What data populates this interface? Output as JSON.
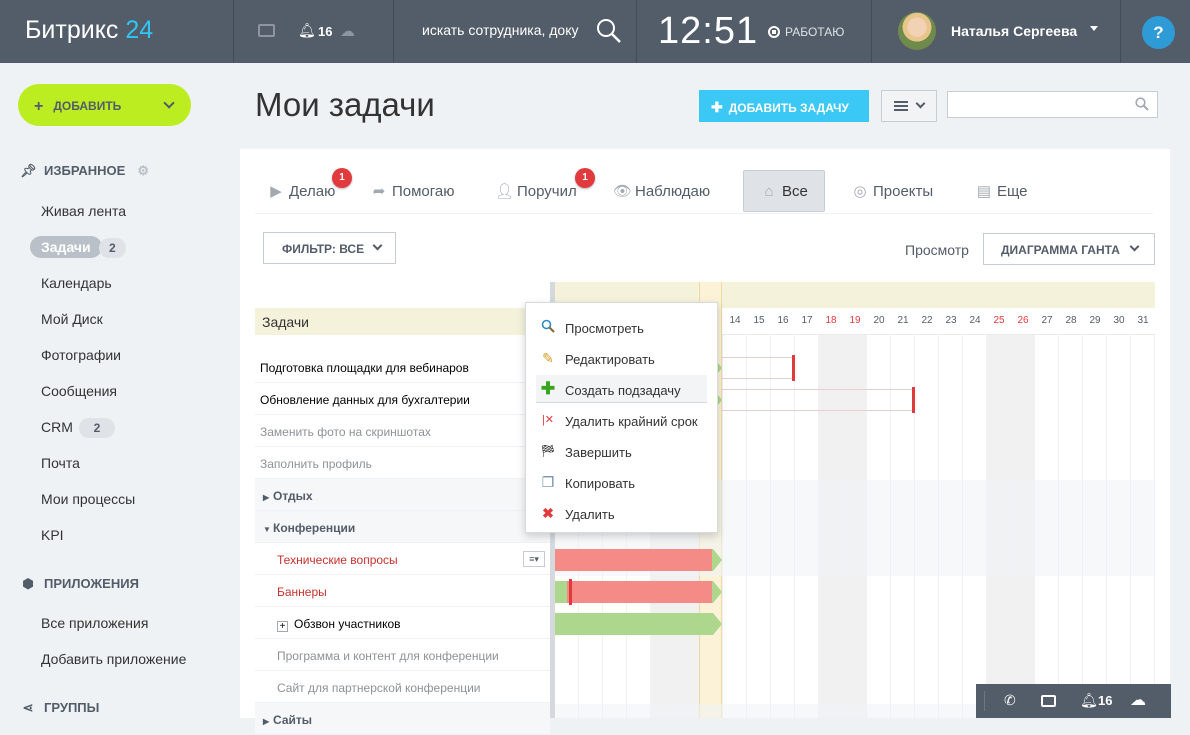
{
  "topbar": {
    "logo_word": "Битрикс",
    "logo_num": "24",
    "notif_count": "16",
    "search_placeholder": "искать сотрудника, доку",
    "time": "12:51",
    "work_status": "РАБОТАЮ",
    "user_name": "Наталья Сергеева",
    "help": "?"
  },
  "sidebar": {
    "add_label": "ДОБАВИТЬ",
    "fav_header": "ИЗБРАННОЕ",
    "items": [
      {
        "label": "Живая лента"
      },
      {
        "label": "Задачи",
        "count": "2"
      },
      {
        "label": "Календарь"
      },
      {
        "label": "Мой Диск"
      },
      {
        "label": "Фотографии"
      },
      {
        "label": "Сообщения"
      },
      {
        "label": "CRM",
        "count": "2"
      },
      {
        "label": "Почта"
      },
      {
        "label": "Мои процессы"
      },
      {
        "label": "KPI"
      }
    ],
    "apps_header": "ПРИЛОЖЕНИЯ",
    "apps": [
      {
        "label": "Все приложения"
      },
      {
        "label": "Добавить приложение"
      }
    ],
    "groups_header": "ГРУППЫ"
  },
  "page": {
    "title": "Мои задачи",
    "add_task": "ДОБАВИТЬ ЗАДАЧУ",
    "search_value": ""
  },
  "tabs": [
    {
      "label": "Делаю",
      "count": "1"
    },
    {
      "label": "Помогаю"
    },
    {
      "label": "Поручил",
      "count": "1"
    },
    {
      "label": "Наблюдаю"
    },
    {
      "label": "Все"
    },
    {
      "label": "Проекты"
    },
    {
      "label": "Еще"
    }
  ],
  "filter": {
    "label": "ФИЛЬТР: ВСЕ"
  },
  "view": {
    "label": "Просмотр",
    "value": "ДИАГРАММА ГАНТА"
  },
  "tasks": {
    "header": "Задачи",
    "rows": [
      {
        "label": "Подготовка площадки для вебинаров"
      },
      {
        "label": "Обновление данных для бухгалтерии"
      },
      {
        "label": "Заменить фото на скриншотах"
      },
      {
        "label": "Заполнить профиль"
      },
      {
        "label": "Отдых"
      },
      {
        "label": "Конференции"
      },
      {
        "label": "Технические вопросы"
      },
      {
        "label": "Баннеры"
      },
      {
        "label": "Обзвон участников"
      },
      {
        "label": "Программа и контент для конференции"
      },
      {
        "label": "Сайт для партнерской конференции"
      },
      {
        "label": "Сайты"
      }
    ]
  },
  "gantt": {
    "days": [
      "14",
      "15",
      "16",
      "17",
      "18",
      "19",
      "20",
      "21",
      "22",
      "23",
      "24",
      "25",
      "26",
      "27",
      "28",
      "29",
      "30",
      "31"
    ],
    "weekend_days": [
      "18",
      "19",
      "25",
      "26"
    ]
  },
  "context_menu": [
    {
      "label": "Просмотреть",
      "icon": "magnifier-icon"
    },
    {
      "label": "Редактировать",
      "icon": "pencil-icon"
    },
    {
      "label": "Создать подзадачу",
      "icon": "plus-icon"
    },
    {
      "label": "Удалить крайний срок",
      "icon": "remove-deadline-icon"
    },
    {
      "label": "Завершить",
      "icon": "finish-flag-icon"
    },
    {
      "label": "Копировать",
      "icon": "copy-icon"
    },
    {
      "label": "Удалить",
      "icon": "delete-icon"
    }
  ],
  "bottombar": {
    "notif_count": "16"
  },
  "colors": {
    "topbar": "#535c69",
    "accent_green": "#bbed21",
    "accent_blue": "#3bc8f5",
    "bar_red": "#f58b87",
    "bar_green": "#acd78d",
    "weekend": "#e03a3e"
  }
}
